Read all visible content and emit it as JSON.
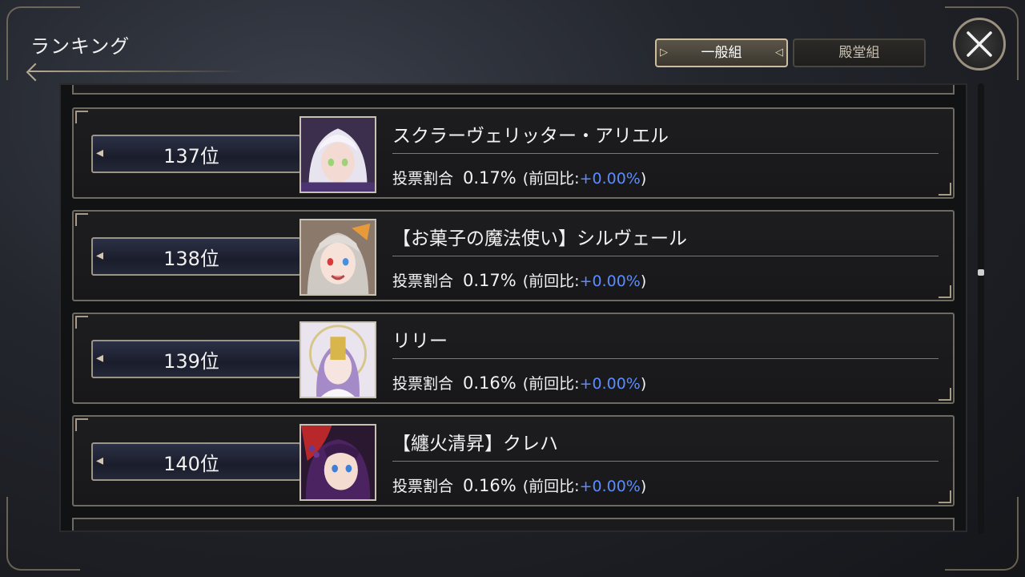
{
  "header": {
    "title": "ランキング"
  },
  "tabs": [
    {
      "label": "一般組",
      "active": true
    },
    {
      "label": "殿堂組",
      "active": false
    }
  ],
  "rows": [
    {
      "rank": "137位",
      "name": "スクラーヴェリッター・アリエル",
      "vote_label": "投票割合",
      "percent": "0.17%",
      "prev_prefix": "(前回比:",
      "prev_value": "+0.00%",
      "prev_suffix": ")"
    },
    {
      "rank": "138位",
      "name": "【お菓子の魔法使い】シルヴェール",
      "vote_label": "投票割合",
      "percent": "0.17%",
      "prev_prefix": "(前回比:",
      "prev_value": "+0.00%",
      "prev_suffix": ")"
    },
    {
      "rank": "139位",
      "name": "リリー",
      "vote_label": "投票割合",
      "percent": "0.16%",
      "prev_prefix": "(前回比:",
      "prev_value": "+0.00%",
      "prev_suffix": ")"
    },
    {
      "rank": "140位",
      "name": "【纏火清昇】クレハ",
      "vote_label": "投票割合",
      "percent": "0.16%",
      "prev_prefix": "(前回比:",
      "prev_value": "+0.00%",
      "prev_suffix": ")"
    }
  ],
  "colors": {
    "accent_delta": "#5b8cff",
    "frame_gold": "#b7aa92"
  },
  "icons": {
    "close": "close-icon"
  }
}
